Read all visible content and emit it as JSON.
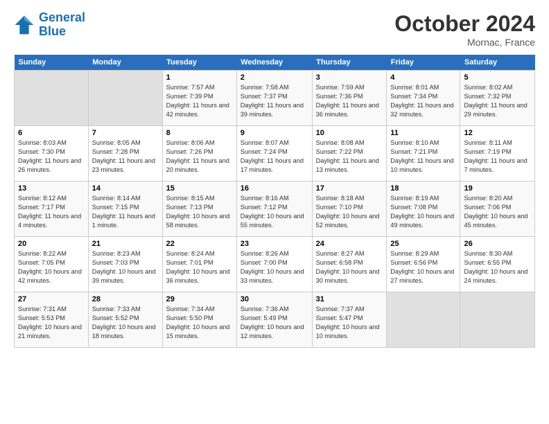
{
  "header": {
    "logo_line1": "General",
    "logo_line2": "Blue",
    "month": "October 2024",
    "location": "Mornac, France"
  },
  "weekdays": [
    "Sunday",
    "Monday",
    "Tuesday",
    "Wednesday",
    "Thursday",
    "Friday",
    "Saturday"
  ],
  "weeks": [
    [
      {
        "day": "",
        "info": ""
      },
      {
        "day": "",
        "info": ""
      },
      {
        "day": "1",
        "info": "Sunrise: 7:57 AM\nSunset: 7:39 PM\nDaylight: 11 hours and 42 minutes."
      },
      {
        "day": "2",
        "info": "Sunrise: 7:58 AM\nSunset: 7:37 PM\nDaylight: 11 hours and 39 minutes."
      },
      {
        "day": "3",
        "info": "Sunrise: 7:59 AM\nSunset: 7:36 PM\nDaylight: 11 hours and 36 minutes."
      },
      {
        "day": "4",
        "info": "Sunrise: 8:01 AM\nSunset: 7:34 PM\nDaylight: 11 hours and 32 minutes."
      },
      {
        "day": "5",
        "info": "Sunrise: 8:02 AM\nSunset: 7:32 PM\nDaylight: 11 hours and 29 minutes."
      }
    ],
    [
      {
        "day": "6",
        "info": "Sunrise: 8:03 AM\nSunset: 7:30 PM\nDaylight: 11 hours and 26 minutes."
      },
      {
        "day": "7",
        "info": "Sunrise: 8:05 AM\nSunset: 7:28 PM\nDaylight: 11 hours and 23 minutes."
      },
      {
        "day": "8",
        "info": "Sunrise: 8:06 AM\nSunset: 7:26 PM\nDaylight: 11 hours and 20 minutes."
      },
      {
        "day": "9",
        "info": "Sunrise: 8:07 AM\nSunset: 7:24 PM\nDaylight: 11 hours and 17 minutes."
      },
      {
        "day": "10",
        "info": "Sunrise: 8:08 AM\nSunset: 7:22 PM\nDaylight: 11 hours and 13 minutes."
      },
      {
        "day": "11",
        "info": "Sunrise: 8:10 AM\nSunset: 7:21 PM\nDaylight: 11 hours and 10 minutes."
      },
      {
        "day": "12",
        "info": "Sunrise: 8:11 AM\nSunset: 7:19 PM\nDaylight: 11 hours and 7 minutes."
      }
    ],
    [
      {
        "day": "13",
        "info": "Sunrise: 8:12 AM\nSunset: 7:17 PM\nDaylight: 11 hours and 4 minutes."
      },
      {
        "day": "14",
        "info": "Sunrise: 8:14 AM\nSunset: 7:15 PM\nDaylight: 11 hours and 1 minute."
      },
      {
        "day": "15",
        "info": "Sunrise: 8:15 AM\nSunset: 7:13 PM\nDaylight: 10 hours and 58 minutes."
      },
      {
        "day": "16",
        "info": "Sunrise: 8:16 AM\nSunset: 7:12 PM\nDaylight: 10 hours and 55 minutes."
      },
      {
        "day": "17",
        "info": "Sunrise: 8:18 AM\nSunset: 7:10 PM\nDaylight: 10 hours and 52 minutes."
      },
      {
        "day": "18",
        "info": "Sunrise: 8:19 AM\nSunset: 7:08 PM\nDaylight: 10 hours and 49 minutes."
      },
      {
        "day": "19",
        "info": "Sunrise: 8:20 AM\nSunset: 7:06 PM\nDaylight: 10 hours and 45 minutes."
      }
    ],
    [
      {
        "day": "20",
        "info": "Sunrise: 8:22 AM\nSunset: 7:05 PM\nDaylight: 10 hours and 42 minutes."
      },
      {
        "day": "21",
        "info": "Sunrise: 8:23 AM\nSunset: 7:03 PM\nDaylight: 10 hours and 39 minutes."
      },
      {
        "day": "22",
        "info": "Sunrise: 8:24 AM\nSunset: 7:01 PM\nDaylight: 10 hours and 36 minutes."
      },
      {
        "day": "23",
        "info": "Sunrise: 8:26 AM\nSunset: 7:00 PM\nDaylight: 10 hours and 33 minutes."
      },
      {
        "day": "24",
        "info": "Sunrise: 8:27 AM\nSunset: 6:58 PM\nDaylight: 10 hours and 30 minutes."
      },
      {
        "day": "25",
        "info": "Sunrise: 8:29 AM\nSunset: 6:56 PM\nDaylight: 10 hours and 27 minutes."
      },
      {
        "day": "26",
        "info": "Sunrise: 8:30 AM\nSunset: 6:55 PM\nDaylight: 10 hours and 24 minutes."
      }
    ],
    [
      {
        "day": "27",
        "info": "Sunrise: 7:31 AM\nSunset: 5:53 PM\nDaylight: 10 hours and 21 minutes."
      },
      {
        "day": "28",
        "info": "Sunrise: 7:33 AM\nSunset: 5:52 PM\nDaylight: 10 hours and 18 minutes."
      },
      {
        "day": "29",
        "info": "Sunrise: 7:34 AM\nSunset: 5:50 PM\nDaylight: 10 hours and 15 minutes."
      },
      {
        "day": "30",
        "info": "Sunrise: 7:36 AM\nSunset: 5:49 PM\nDaylight: 10 hours and 12 minutes."
      },
      {
        "day": "31",
        "info": "Sunrise: 7:37 AM\nSunset: 5:47 PM\nDaylight: 10 hours and 10 minutes."
      },
      {
        "day": "",
        "info": ""
      },
      {
        "day": "",
        "info": ""
      }
    ]
  ]
}
